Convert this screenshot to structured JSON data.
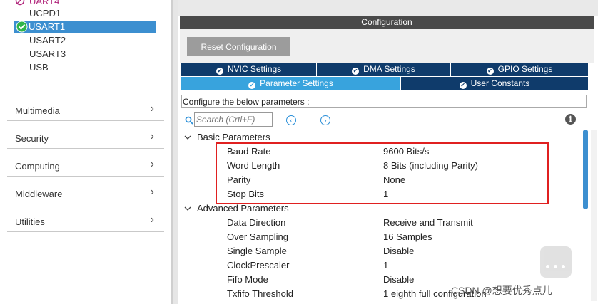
{
  "left": {
    "peripherals": [
      {
        "label": "UART4",
        "status": "disabled"
      },
      {
        "label": "UCPD1"
      },
      {
        "label": "USART1",
        "selected": true,
        "status": "enabled"
      },
      {
        "label": "USART2"
      },
      {
        "label": "USART3"
      },
      {
        "label": "USB"
      }
    ],
    "categories": [
      "Multimedia",
      "Security",
      "Computing",
      "Middleware",
      "Utilities"
    ]
  },
  "config": {
    "title": "Configuration",
    "reset_label": "Reset Configuration",
    "tabs_row1": [
      "NVIC Settings",
      "DMA Settings",
      "GPIO Settings"
    ],
    "tabs_row2": [
      "Parameter Settings",
      "User Constants"
    ],
    "active_tab": "Parameter Settings",
    "prompt": "Configure the below parameters :",
    "search_placeholder": "Search (Crtl+F)",
    "info_label": "i",
    "groups": [
      {
        "title": "Basic Parameters",
        "rows": [
          {
            "name": "Baud Rate",
            "value": "9600 Bits/s"
          },
          {
            "name": "Word Length",
            "value": "8 Bits (including Parity)"
          },
          {
            "name": "Parity",
            "value": "None"
          },
          {
            "name": "Stop Bits",
            "value": "1"
          }
        ]
      },
      {
        "title": "Advanced Parameters",
        "rows": [
          {
            "name": "Data Direction",
            "value": "Receive and Transmit"
          },
          {
            "name": "Over Sampling",
            "value": "16 Samples"
          },
          {
            "name": "Single Sample",
            "value": "Disable"
          },
          {
            "name": "ClockPrescaler",
            "value": "1"
          },
          {
            "name": "Fifo Mode",
            "value": "Disable"
          },
          {
            "name": "Txfifo Threshold",
            "value": "1 eighth full configuration"
          }
        ]
      }
    ]
  },
  "watermark": "CSDN @想要优秀点儿",
  "colors": {
    "accent": "#38a3dd",
    "tab_dark": "#0f3b6b",
    "highlight": "#e02020",
    "selected": "#3c8fd0"
  }
}
